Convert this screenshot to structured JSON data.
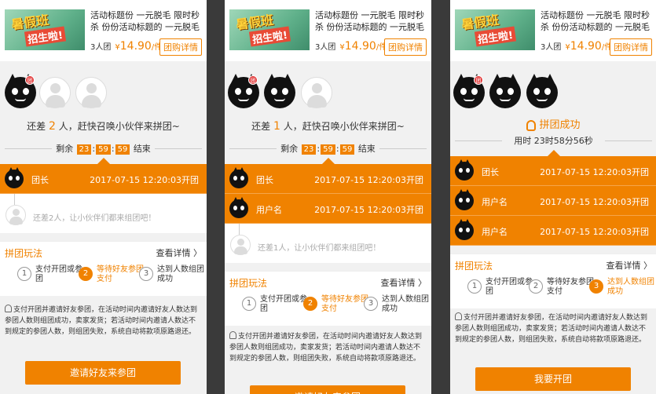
{
  "product": {
    "thumb_text_1": "暑假班",
    "thumb_text_2": "招生啦!",
    "title": "活动标题份 一元脱毛 限时秒杀 份份活动标题的 一元脱毛 限时秒杀 份份",
    "group_size": "3人团",
    "price_symbol": "¥",
    "price": "14.90",
    "price_unit": "/件",
    "detail_button": "团购详情"
  },
  "panels": [
    {
      "status_prefix": "还差",
      "status_num": "2",
      "status_suffix": "人，赶快召唤小伙伴来拼团~",
      "timer_prefix": "剩余",
      "timer_h": "23",
      "timer_m": "59",
      "timer_s": "59",
      "timer_suffix": "结束",
      "badge": "团",
      "rows": [
        {
          "name": "团长",
          "time": "2017-07-15 12:20:03开团"
        }
      ],
      "waiting": "还差2人，让小伙伴们都来组团吧！",
      "button": "邀请好友来参团"
    },
    {
      "status_prefix": "还差",
      "status_num": "1",
      "status_suffix": "人，赶快召唤小伙伴来拼团~",
      "timer_prefix": "剩余",
      "timer_h": "23",
      "timer_m": "59",
      "timer_s": "59",
      "timer_suffix": "结束",
      "badge": "团",
      "rows": [
        {
          "name": "团长",
          "time": "2017-07-15 12:20:03开团"
        },
        {
          "name": "用户名",
          "time": "2017-07-15 12:20:03开团"
        }
      ],
      "waiting": "还差1人，让小伙伴们都来组团吧！",
      "button": "邀请好友来参团"
    },
    {
      "success_title": "拼团成功",
      "success_time": "用时 23时58分56秒",
      "badge": "团",
      "rows": [
        {
          "name": "团长",
          "time": "2017-07-15 12:20:03开团"
        },
        {
          "name": "用户名",
          "time": "2017-07-15 12:20:03开团"
        },
        {
          "name": "用户名",
          "time": "2017-07-15 12:20:03开团"
        }
      ],
      "button": "我要开团"
    }
  ],
  "rules": {
    "title": "拼团玩法",
    "more": "查看详情 〉",
    "steps": [
      {
        "num": "1",
        "text": "支付开团或参团"
      },
      {
        "num": "2",
        "text": "等待好友参团支付"
      },
      {
        "num": "3",
        "text": "达到人数组团成功"
      }
    ],
    "description": "支付开团并邀请好友参团，在活动时间内邀请好友人数达到参团人数则组团成功，卖家发货；若活动时间内邀请人数达不到规定的参团人数，则组团失败，系统自动将款项原路退还。"
  }
}
